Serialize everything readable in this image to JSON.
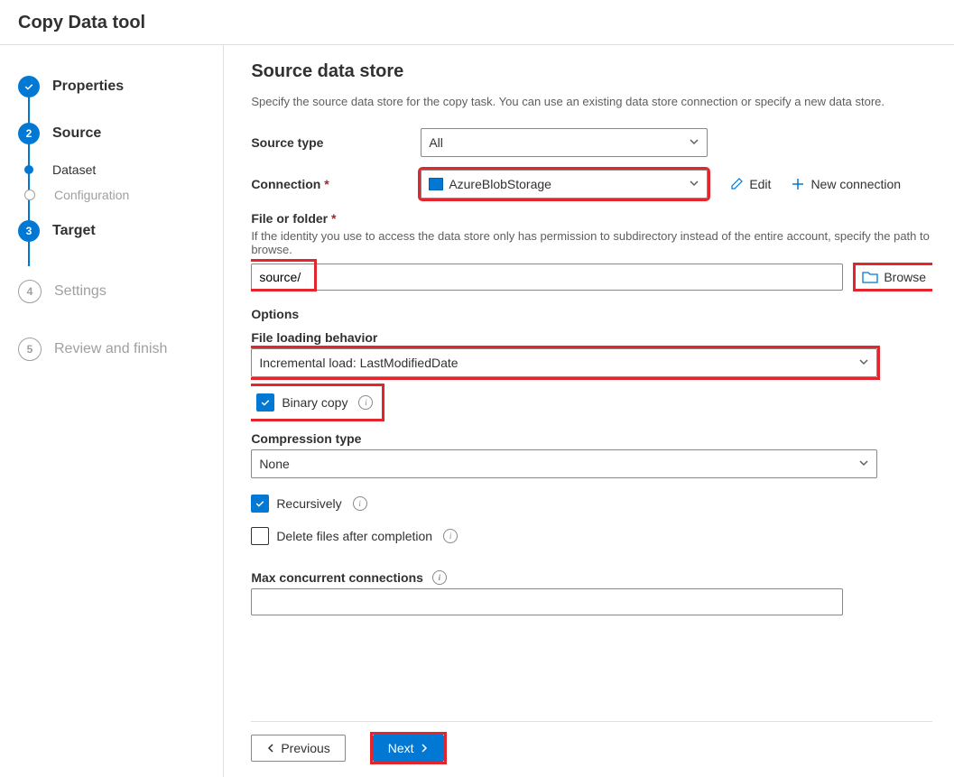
{
  "header": {
    "title": "Copy Data tool"
  },
  "sidebar": {
    "steps": [
      {
        "label": "Properties"
      },
      {
        "label": "Source"
      },
      {
        "label": "Dataset"
      },
      {
        "label": "Configuration"
      },
      {
        "label": "Target"
      },
      {
        "label": "Settings",
        "num": "4"
      },
      {
        "label": "Review and finish",
        "num": "5"
      }
    ]
  },
  "main": {
    "title": "Source data store",
    "description": "Specify the source data store for the copy task. You can use an existing data store connection or specify a new data store.",
    "source_type_label": "Source type",
    "source_type_value": "All",
    "connection_label": "Connection",
    "connection_value": "AzureBlobStorage",
    "edit_label": "Edit",
    "new_connection_label": "New connection",
    "file_or_folder_label": "File or folder",
    "file_or_folder_help": "If the identity you use to access the data store only has permission to subdirectory instead of the entire account, specify the path to browse.",
    "file_or_folder_value": "source/",
    "browse_label": "Browse",
    "options_label": "Options",
    "file_loading_label": "File loading behavior",
    "file_loading_value": "Incremental load: LastModifiedDate",
    "binary_copy_label": "Binary copy",
    "compression_type_label": "Compression type",
    "compression_type_value": "None",
    "recursively_label": "Recursively",
    "delete_files_label": "Delete files after completion",
    "max_concurrent_label": "Max concurrent connections",
    "max_concurrent_value": ""
  },
  "footer": {
    "previous": "Previous",
    "next": "Next"
  }
}
